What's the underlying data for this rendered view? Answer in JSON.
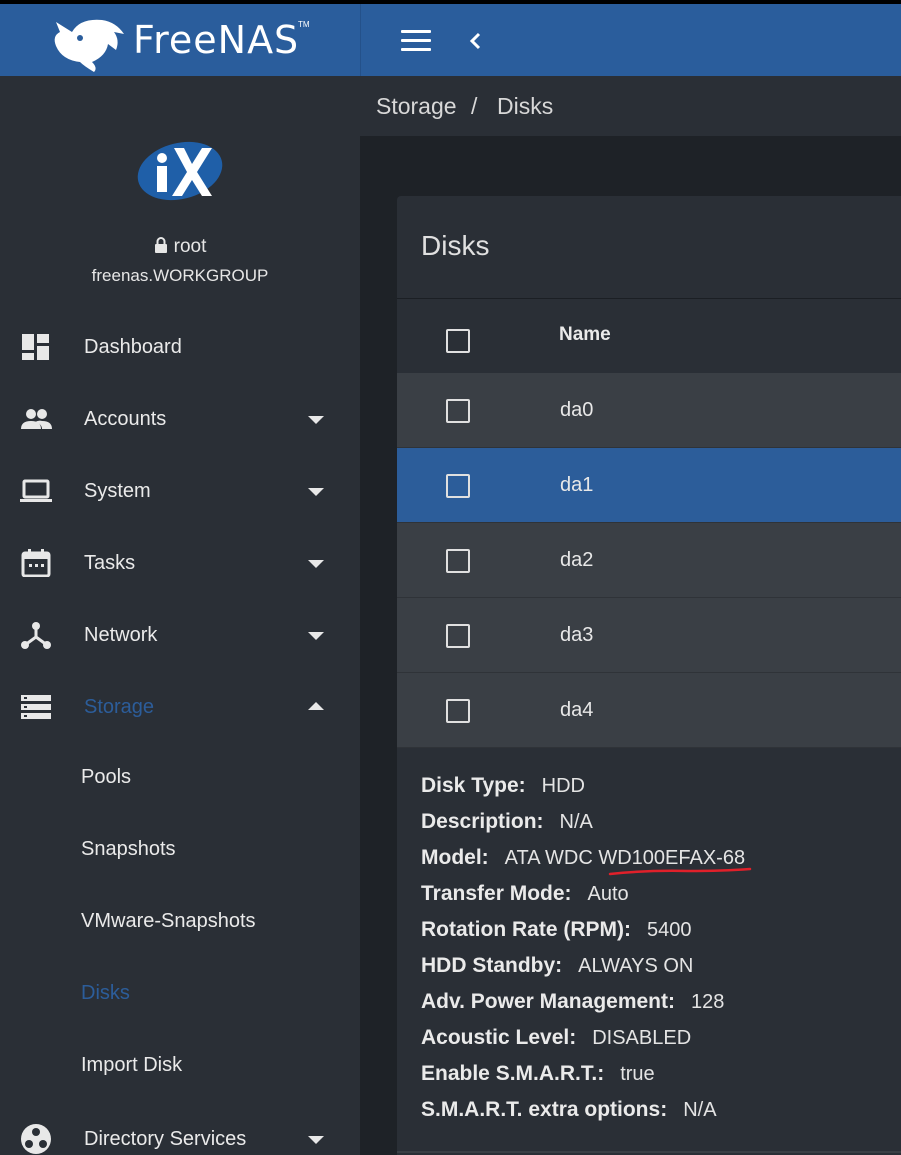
{
  "brand": {
    "name": "FreeNAS",
    "logo_icon": "shark-icon"
  },
  "header": {
    "menu_icon": "hamburger-icon",
    "back_icon": "chevron-left-icon"
  },
  "sidebar": {
    "user": "root",
    "hostname": "freenas.WORKGROUP",
    "items": [
      {
        "label": "Dashboard",
        "icon": "dashboard-icon"
      },
      {
        "label": "Accounts",
        "icon": "people-icon"
      },
      {
        "label": "System",
        "icon": "laptop-icon"
      },
      {
        "label": "Tasks",
        "icon": "calendar-icon"
      },
      {
        "label": "Network",
        "icon": "network-icon"
      },
      {
        "label": "Storage",
        "icon": "storage-icon"
      }
    ],
    "storage_sub": [
      {
        "label": "Pools"
      },
      {
        "label": "Snapshots"
      },
      {
        "label": "VMware-Snapshots"
      },
      {
        "label": "Disks"
      },
      {
        "label": "Import Disk"
      }
    ],
    "directory": {
      "label": "Directory Services",
      "icon": "directory-services-icon"
    }
  },
  "breadcrumb": {
    "parent": "Storage",
    "separator": "/",
    "current": "Disks"
  },
  "card": {
    "title": "Disks",
    "column_name": "Name",
    "rows": [
      {
        "name": "da0"
      },
      {
        "name": "da1"
      },
      {
        "name": "da2"
      },
      {
        "name": "da3"
      },
      {
        "name": "da4"
      }
    ],
    "details": [
      {
        "key": "Disk Type:",
        "value": "HDD"
      },
      {
        "key": "Description:",
        "value": "N/A"
      },
      {
        "key": "Model:",
        "value": "ATA WDC WD100EFAX-68"
      },
      {
        "key": "Transfer Mode:",
        "value": "Auto"
      },
      {
        "key": "Rotation Rate (RPM):",
        "value": "5400"
      },
      {
        "key": "HDD Standby:",
        "value": "ALWAYS ON"
      },
      {
        "key": "Adv. Power Management:",
        "value": "128"
      },
      {
        "key": "Acoustic Level:",
        "value": "DISABLED"
      },
      {
        "key": "Enable S.M.A.R.T.:",
        "value": "true"
      },
      {
        "key": "S.M.A.R.T. extra options:",
        "value": "N/A"
      }
    ]
  },
  "colors": {
    "header": "#2a5d9c",
    "sidebar": "#2a2f36",
    "accent": "#2c5d9a",
    "annotation": "#e0202a"
  }
}
